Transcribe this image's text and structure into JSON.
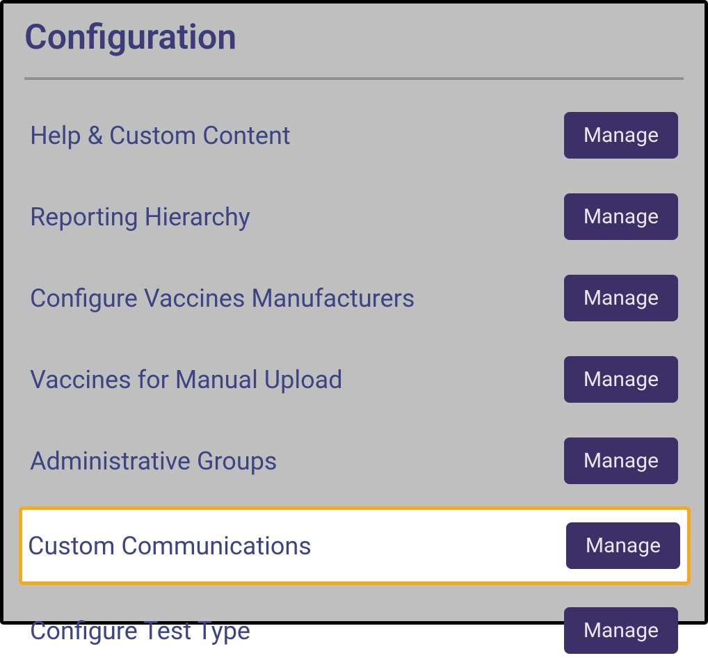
{
  "title": "Configuration",
  "items": [
    {
      "label": "Help & Custom Content",
      "button": "Manage",
      "highlighted": false
    },
    {
      "label": "Reporting Hierarchy",
      "button": "Manage",
      "highlighted": false
    },
    {
      "label": "Configure Vaccines Manufacturers",
      "button": "Manage",
      "highlighted": false
    },
    {
      "label": "Vaccines for Manual Upload",
      "button": "Manage",
      "highlighted": false
    },
    {
      "label": "Administrative Groups",
      "button": "Manage",
      "highlighted": false
    },
    {
      "label": "Custom Communications",
      "button": "Manage",
      "highlighted": true
    },
    {
      "label": "Configure Test Type",
      "button": "Manage",
      "highlighted": false
    }
  ]
}
